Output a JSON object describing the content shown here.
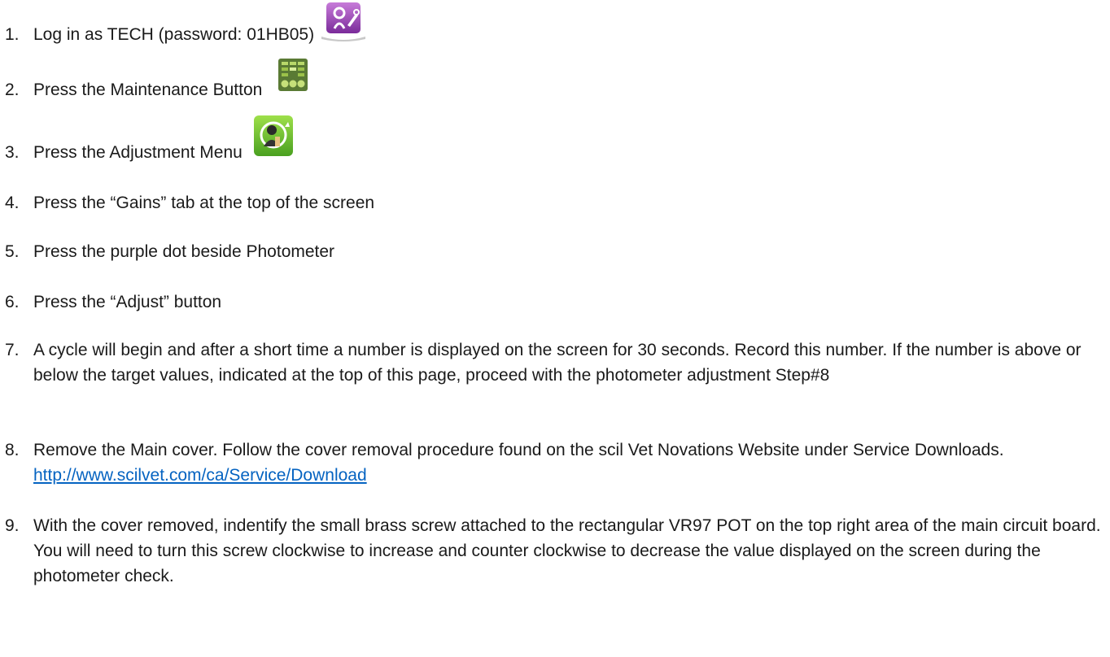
{
  "steps": [
    {
      "num": "1.",
      "text": "Log in as TECH (password: 01HB05)",
      "icon": "tech-login-icon"
    },
    {
      "num": "2.",
      "text": "Press the Maintenance Button",
      "icon": "maintenance-icon"
    },
    {
      "num": "3.",
      "text": "Press the Adjustment Menu",
      "icon": "adjustment-icon"
    },
    {
      "num": "4.",
      "text": "Press the “Gains” tab at the top of the screen"
    },
    {
      "num": "5.",
      "text": "Press the purple dot beside Photometer"
    },
    {
      "num": "6.",
      "text": "Press the “Adjust” button"
    },
    {
      "num": "7.",
      "text": "A cycle will begin and after a short time a number is displayed on the screen for 30 seconds. Record this number. If the number is above or below the target values, indicated at the top of this page, proceed with the photometer adjustment Step#8"
    },
    {
      "num": "8.",
      "text": "Remove the Main cover. Follow the cover removal procedure found on the scil Vet Novations Website under Service Downloads.",
      "link": "http://www.scilvet.com/ca/Service/Download"
    },
    {
      "num": "9.",
      "text": "With the cover removed, indentify the small brass screw attached to the rectangular VR97 POT on the top right area of the main circuit board. You will need to turn this screw clockwise to increase and counter clockwise to decrease the value displayed on the screen during the photometer check."
    }
  ]
}
